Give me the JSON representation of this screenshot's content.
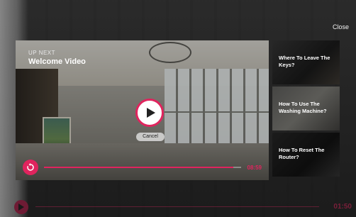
{
  "close_label": "Close",
  "up_next": {
    "label": "UP NEXT",
    "title": "Welcome Video",
    "cancel_label": "Cancel",
    "timestamp": "08:59",
    "progress": 0.96
  },
  "playlist": [
    {
      "title": "Where To Leave The Keys?"
    },
    {
      "title": "How To Use The Washing Machine?"
    },
    {
      "title": "How To Reset The Router?"
    }
  ],
  "player": {
    "time": "01:50"
  },
  "colors": {
    "accent": "#e0245e"
  }
}
